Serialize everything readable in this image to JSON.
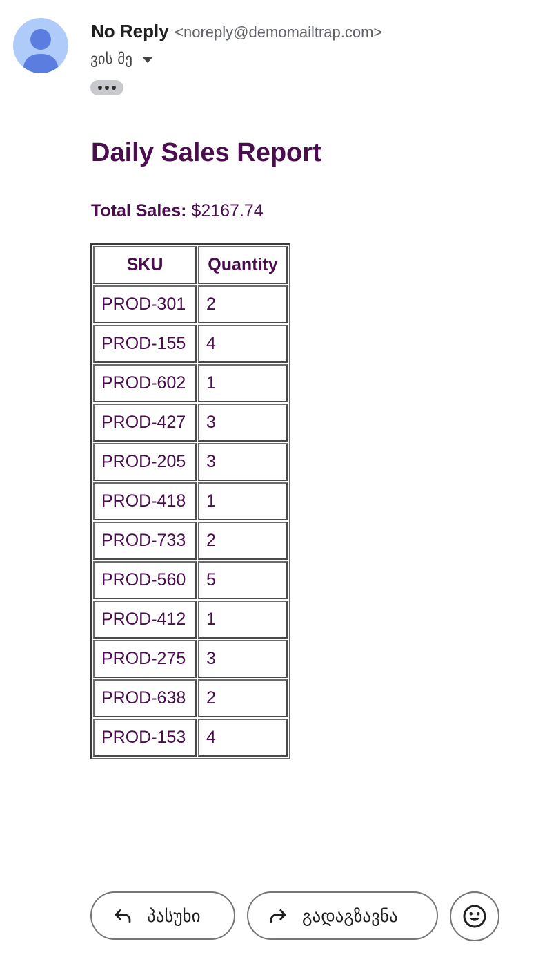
{
  "sender": {
    "name": "No Reply",
    "email": "<noreply@demomailtrap.com>"
  },
  "recipient": {
    "label": "ვის მე"
  },
  "more_button": {
    "icon": "more-horizontal-icon"
  },
  "report": {
    "title": "Daily Sales Report",
    "total_label": "Total Sales:",
    "total_value": "$2167.74"
  },
  "table": {
    "headers": [
      "SKU",
      "Quantity"
    ],
    "rows": [
      [
        "PROD-301",
        "2"
      ],
      [
        "PROD-155",
        "4"
      ],
      [
        "PROD-602",
        "1"
      ],
      [
        "PROD-427",
        "3"
      ],
      [
        "PROD-205",
        "3"
      ],
      [
        "PROD-418",
        "1"
      ],
      [
        "PROD-733",
        "2"
      ],
      [
        "PROD-560",
        "5"
      ],
      [
        "PROD-412",
        "1"
      ],
      [
        "PROD-275",
        "3"
      ],
      [
        "PROD-638",
        "2"
      ],
      [
        "PROD-153",
        "4"
      ]
    ]
  },
  "actions": {
    "reply": "პასუხი",
    "forward": "გადაგზავნა",
    "emoji_icon": "smiley-icon"
  },
  "colors": {
    "report_text": "#4a0e4e",
    "avatar_bg": "#aecbfa",
    "avatar_fg": "#5b7de0",
    "pill_bg": "#c7c9cc"
  }
}
